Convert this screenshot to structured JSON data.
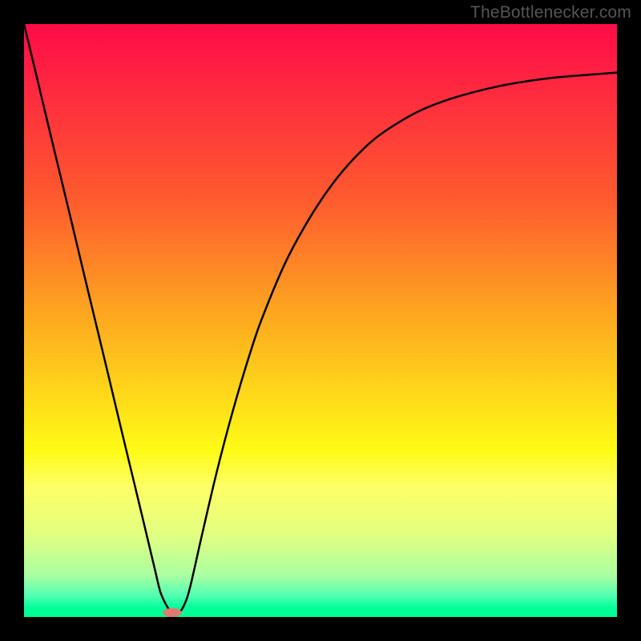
{
  "site": {
    "attribution": "TheBottlenecker.com"
  },
  "chart_data": {
    "type": "line",
    "title": "",
    "xlabel": "",
    "ylabel": "",
    "xlim": [
      0,
      100
    ],
    "ylim": [
      0,
      100
    ],
    "grid": false,
    "legend": false,
    "background_gradient": {
      "stops": [
        {
          "offset": 0.0,
          "color": "#ff0b49"
        },
        {
          "offset": 0.3,
          "color": "#fe5c2e"
        },
        {
          "offset": 0.5,
          "color": "#fdab1f"
        },
        {
          "offset": 0.72,
          "color": "#fefb16"
        },
        {
          "offset": 0.78,
          "color": "#feff66"
        },
        {
          "offset": 0.86,
          "color": "#e3ff80"
        },
        {
          "offset": 0.93,
          "color": "#a9ffa1"
        },
        {
          "offset": 0.965,
          "color": "#4fffb2"
        },
        {
          "offset": 0.985,
          "color": "#00ff9a"
        },
        {
          "offset": 1.0,
          "color": "#00ff8e"
        }
      ]
    },
    "series": [
      {
        "name": "bottleneck-curve",
        "x": [
          0,
          2,
          4,
          6,
          8,
          10,
          12,
          14,
          16,
          18,
          20,
          22,
          23,
          24,
          25,
          26,
          27,
          28,
          30,
          32,
          34,
          36,
          38,
          40,
          44,
          48,
          52,
          56,
          60,
          66,
          72,
          80,
          88,
          96,
          100
        ],
        "y": [
          100,
          91.7,
          83.3,
          75.0,
          66.7,
          58.3,
          50.0,
          41.7,
          33.3,
          25.0,
          16.7,
          8.3,
          4.2,
          2.0,
          0.6,
          0.6,
          2.0,
          5.0,
          13.8,
          22.4,
          30.3,
          37.5,
          44.1,
          50.0,
          59.6,
          67.0,
          73.0,
          77.7,
          81.3,
          85.0,
          87.4,
          89.5,
          90.8,
          91.5,
          91.8
        ]
      }
    ],
    "marker": {
      "name": "optimal-region",
      "x": 25,
      "y": 0,
      "width_pct": 3.2,
      "height_pct": 1.5,
      "color": "#dd7c6f"
    }
  }
}
